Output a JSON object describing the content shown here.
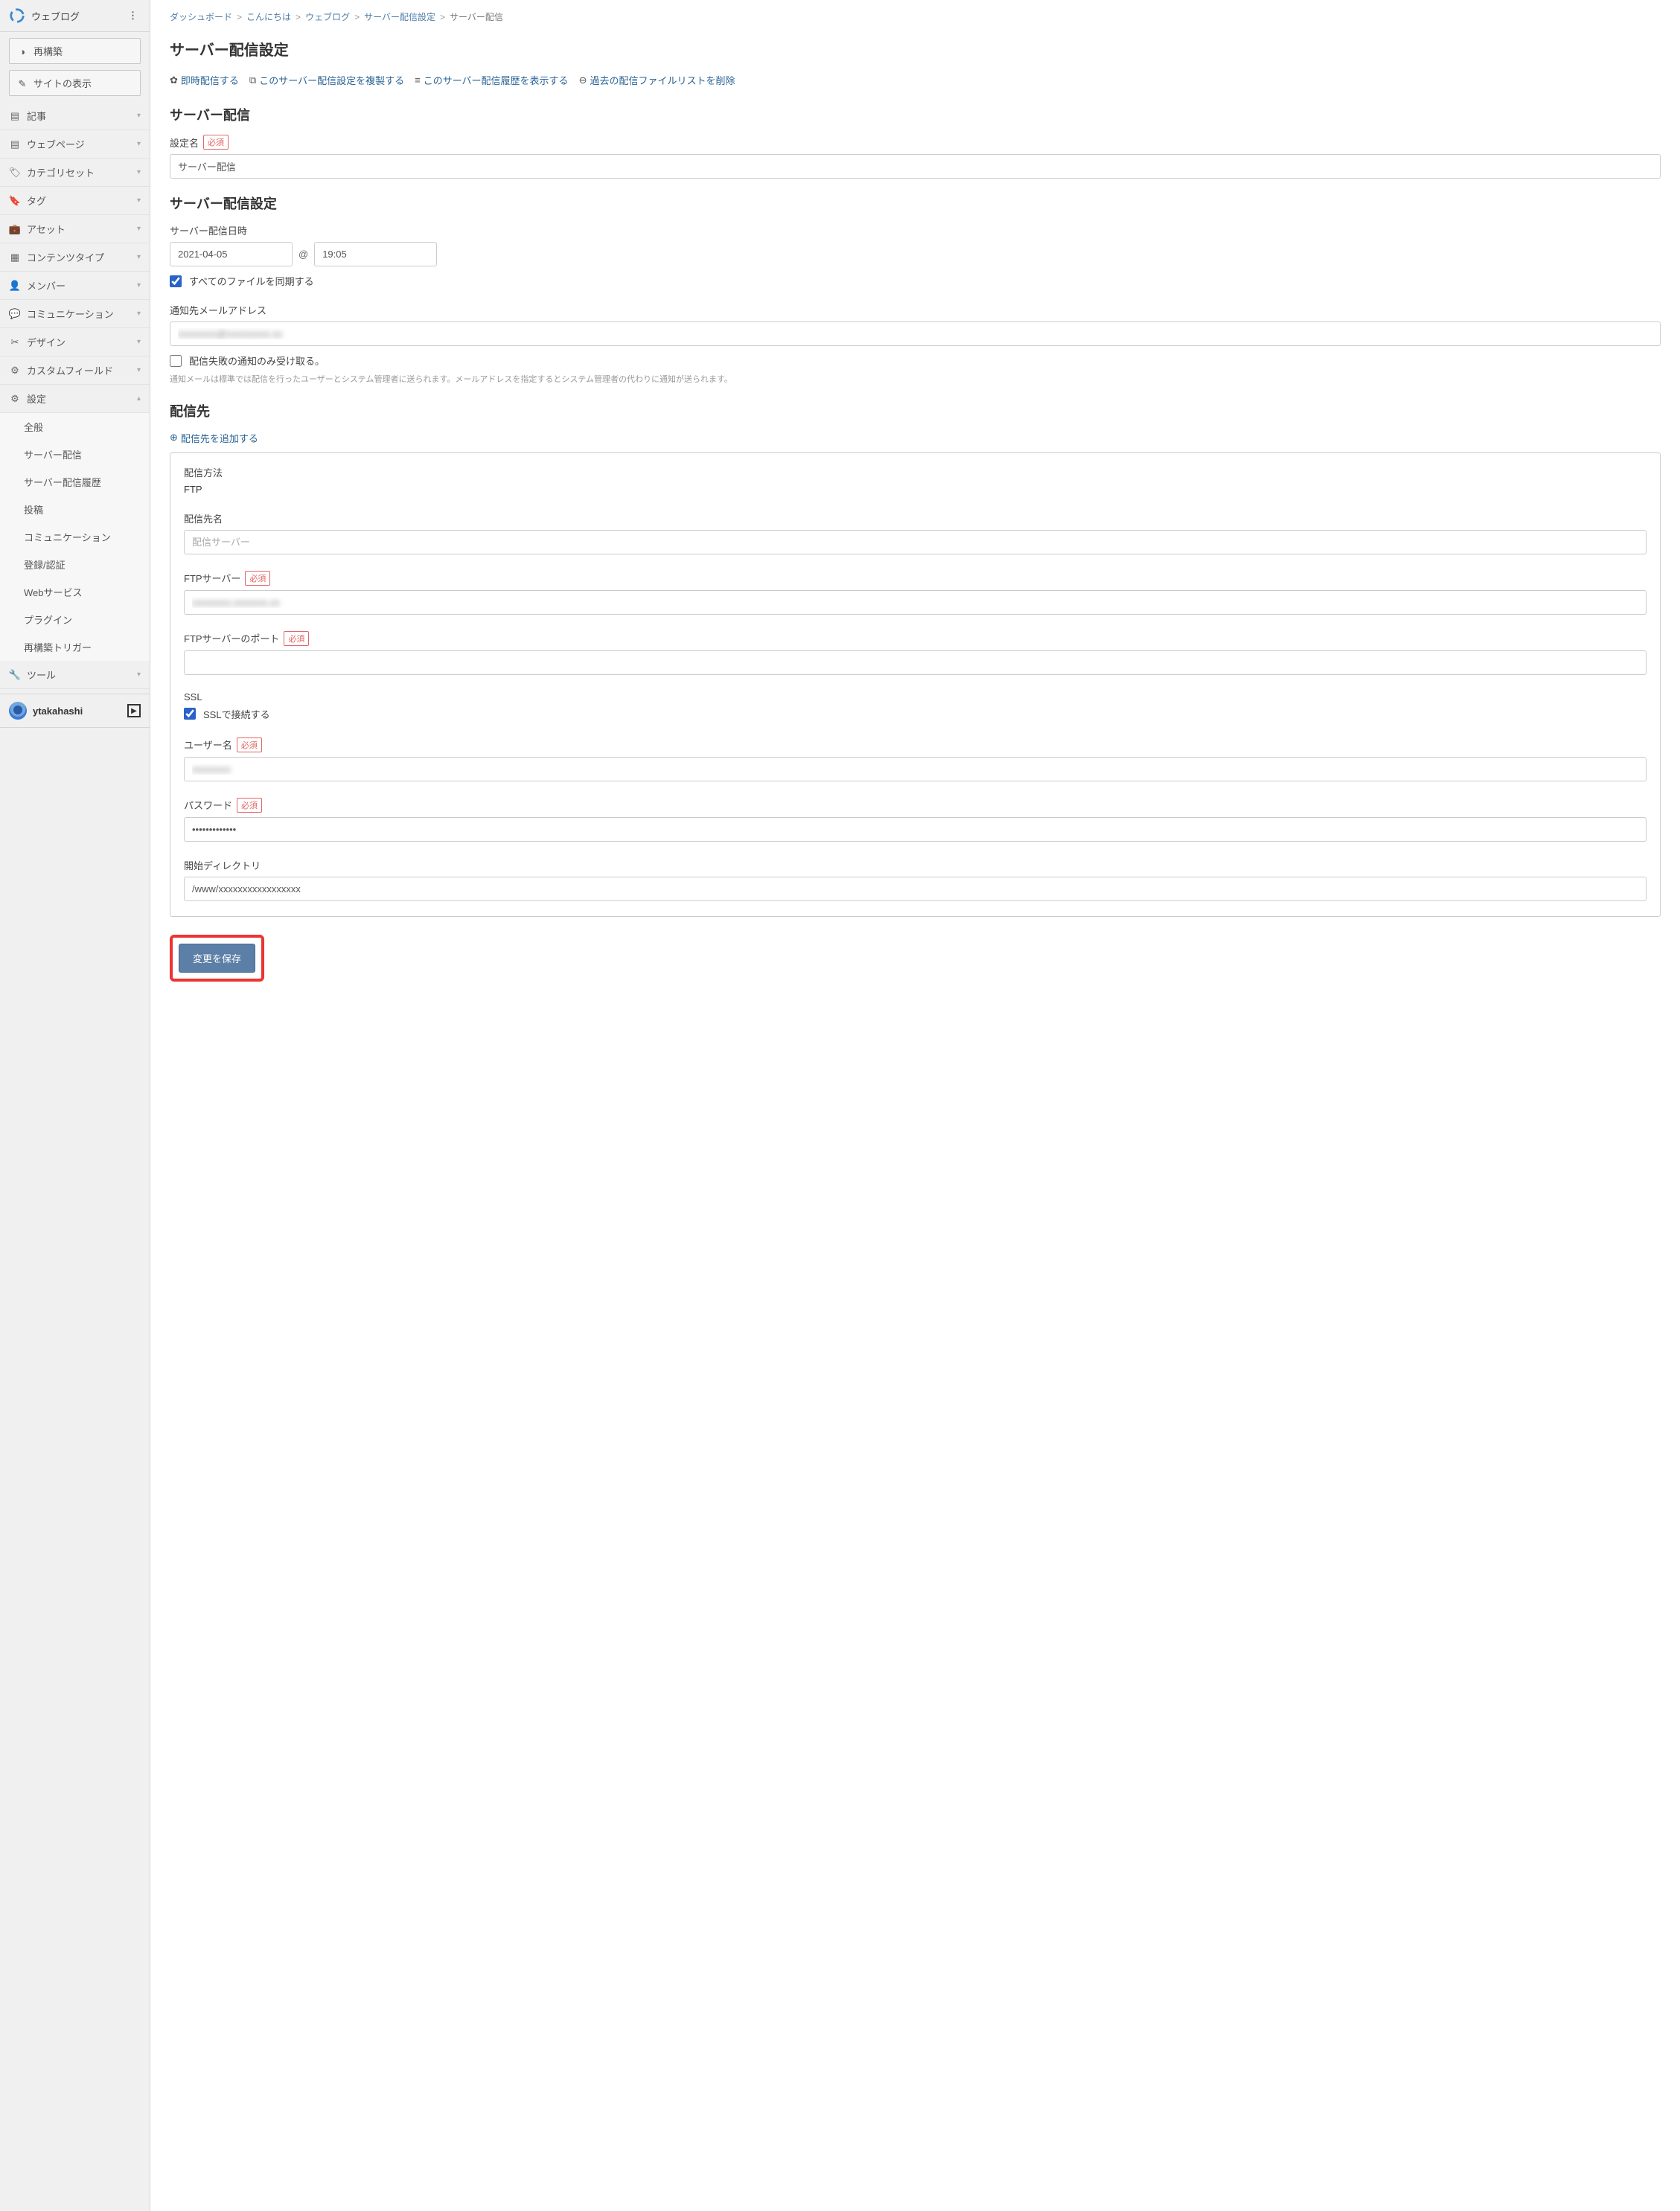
{
  "sidebar": {
    "title": "ウェブログ",
    "rebuild_label": "再構築",
    "viewsite_label": "サイトの表示",
    "items": [
      {
        "icon": "list",
        "label": "記事"
      },
      {
        "icon": "list",
        "label": "ウェブページ"
      },
      {
        "icon": "tags",
        "label": "カテゴリセット"
      },
      {
        "icon": "tag",
        "label": "タグ"
      },
      {
        "icon": "briefcase",
        "label": "アセット"
      },
      {
        "icon": "grid",
        "label": "コンテンツタイプ"
      },
      {
        "icon": "user",
        "label": "メンバー"
      },
      {
        "icon": "chat",
        "label": "コミュニケーション"
      },
      {
        "icon": "tools",
        "label": "デザイン"
      },
      {
        "icon": "puzzle",
        "label": "カスタムフィールド"
      },
      {
        "icon": "gear",
        "label": "設定",
        "expanded": true
      }
    ],
    "settings_sub": [
      "全般",
      "サーバー配信",
      "サーバー配信履歴",
      "投稿",
      "コミュニケーション",
      "登録/認証",
      "Webサービス",
      "プラグイン",
      "再構築トリガー"
    ],
    "tools_label": "ツール",
    "user": "ytakahashi"
  },
  "crumbs": [
    "ダッシュボード",
    "こんにちは",
    "ウェブログ",
    "サーバー配信設定",
    "サーバー配信"
  ],
  "page_title": "サーバー配信設定",
  "action_links": {
    "immediate": "即時配信する",
    "duplicate": "このサーバー配信設定を複製する",
    "history": "このサーバー配信履歴を表示する",
    "delete_past": "過去の配信ファイルリストを削除"
  },
  "section1": {
    "title": "サーバー配信",
    "name_label": "設定名",
    "required": "必須",
    "name_value": "サーバー配信"
  },
  "section2": {
    "title": "サーバー配信設定",
    "datetime_label": "サーバー配信日時",
    "date_value": "2021-04-05",
    "at": "@",
    "time_value": "19:05",
    "sync_all_label": "すべてのファイルを同期する",
    "email_label": "通知先メールアドレス",
    "email_value": "xxxxxxxx@xxxxxxxxx.xx",
    "fail_only_label": "配信失敗の通知のみ受け取る。",
    "note": "通知メールは標準では配信を行ったユーザーとシステム管理者に送られます。メールアドレスを指定するとシステム管理者の代わりに通知が送られます。"
  },
  "dest": {
    "title": "配信先",
    "add_label": "配信先を追加する",
    "method_label": "配信方法",
    "method_value": "FTP",
    "name_label": "配信先名",
    "name_placeholder": "配信サーバー",
    "server_label": "FTPサーバー",
    "server_value": "xxxxxxxx.xxxxxxx.xx",
    "port_label": "FTPサーバーのポート",
    "port_value": "",
    "ssl_label": "SSL",
    "ssl_text": "SSLで接続する",
    "user_label": "ユーザー名",
    "user_value": "xxxxxxxx",
    "pass_label": "パスワード",
    "pass_value": "•••••••••••••",
    "startdir_label": "開始ディレクトリ",
    "startdir_value": "/www/xxxxxxxxxxxxxxxxx"
  },
  "save_label": "変更を保存"
}
